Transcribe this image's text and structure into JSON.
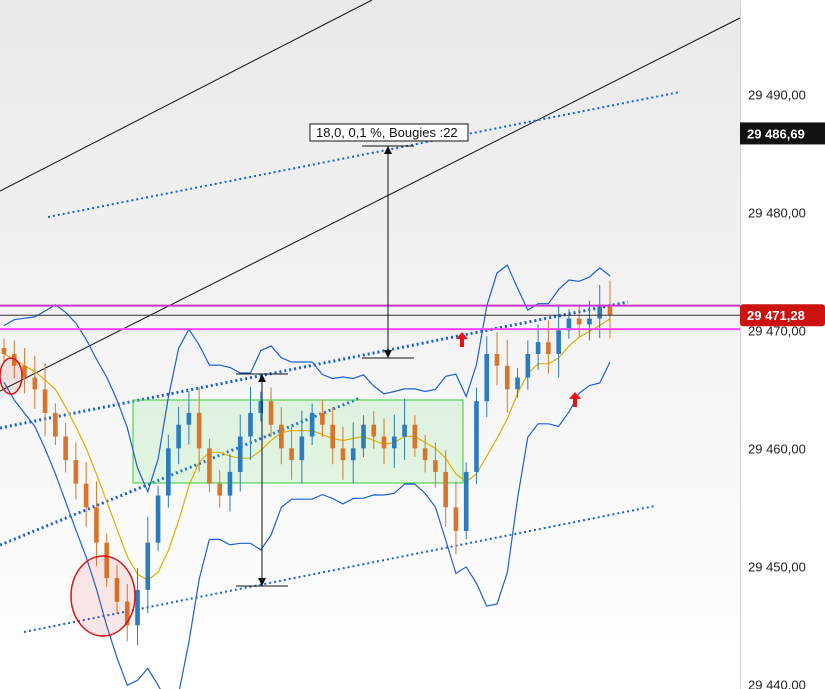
{
  "chart_data": {
    "type": "candlestick",
    "title": "",
    "xlabel": "",
    "ylabel": "",
    "ylim": [
      29439.6,
      29498.0
    ],
    "y_ticks": [
      "29 440,00",
      "29 450,00",
      "29 460,00",
      "29 470,00",
      "29 480,00",
      "29 490,00"
    ],
    "y_tick_values": [
      29440,
      29450,
      29460,
      29470,
      29480,
      29490
    ],
    "grid": false,
    "price_tags": [
      {
        "label": "29 486,69",
        "value": 29486.69,
        "color": "#111111"
      },
      {
        "label": "29 471,28",
        "value": 29471.28,
        "color": "#cc1111"
      }
    ],
    "measurement_label": "18,0, 0,1 %, Bougies :22",
    "horizontal_levels": [
      {
        "value": 29472.1,
        "color": "#cc33cc"
      },
      {
        "value": 29471.28,
        "color": "#333333"
      },
      {
        "value": 29470.1,
        "color": "#ff44ff"
      }
    ],
    "colors": {
      "up": "#2b7bbd",
      "down": "#d9752b",
      "band_upper_lower": "#1f5fd0",
      "band_mid": "#e0b000",
      "trend_dotted": "#1a5fcf",
      "consolidation_box": "#33cc33",
      "ellipse": "#dd1111",
      "arrow": "#ee1111"
    },
    "closes": [
      29468.0,
      29467.0,
      29466.0,
      29465.0,
      29463.0,
      29461.0,
      29459.0,
      29457.0,
      29455.0,
      29452.0,
      29449.0,
      29447.0,
      29445.0,
      29448.0,
      29452.0,
      29456.0,
      29460.0,
      29462.0,
      29463.0,
      29460.0,
      29457.0,
      29456.0,
      29458.0,
      29461.0,
      29463.0,
      29464.0,
      29462.0,
      29460.0,
      29459.0,
      29461.0,
      29463.0,
      29462.0,
      29460.0,
      29459.0,
      29460.0,
      29462.0,
      29461.0,
      29460.0,
      29461.0,
      29462.0,
      29460.0,
      29459.0,
      29458.0,
      29455.0,
      29453.0,
      29458.0,
      29464.0,
      29468.0,
      29467.0,
      29465.0,
      29466.0,
      29468.0,
      29469.0,
      29468.0,
      29470.0,
      29471.0,
      29470.5,
      29471.0,
      29472.0,
      29471.3
    ]
  }
}
